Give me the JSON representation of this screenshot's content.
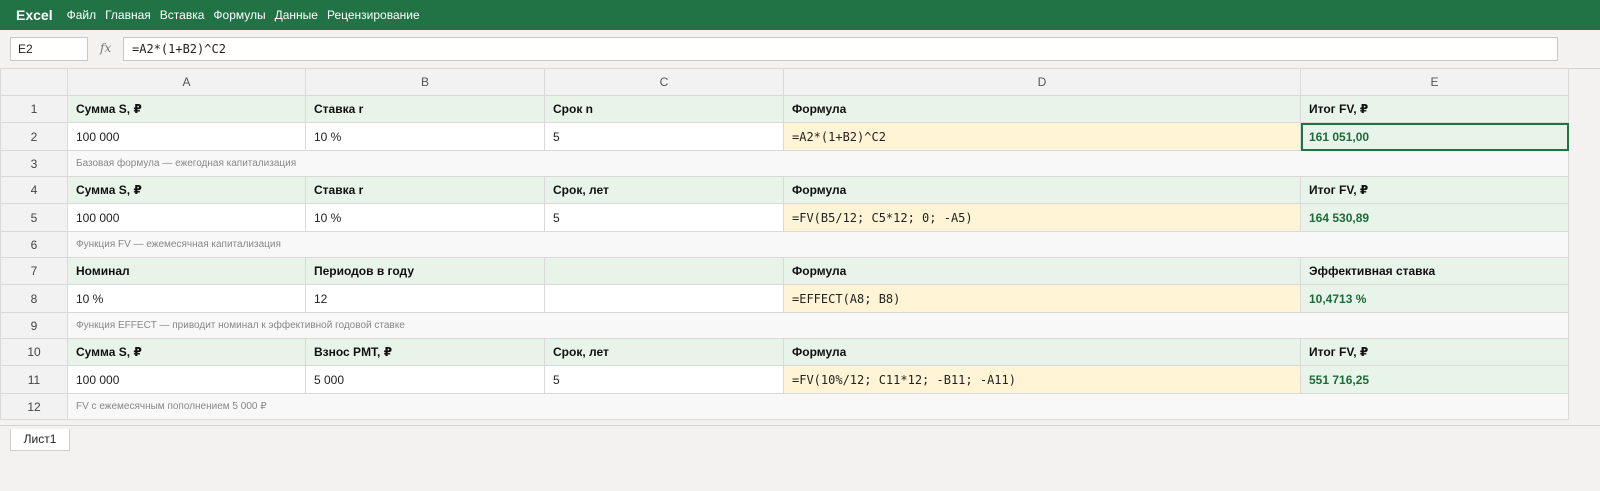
{
  "app": {
    "name": "Excel",
    "menu": [
      "Файл",
      "Главная",
      "Вставка",
      "Формулы",
      "Данные",
      "Рецензирование"
    ]
  },
  "formula_bar": {
    "cell_ref": "E2",
    "fx_label": "fx",
    "formula": "=A2*(1+B2)^C2"
  },
  "grid": {
    "columns": [
      "A",
      "B",
      "C",
      "D",
      "E"
    ],
    "rows": [
      {
        "num": "1",
        "type": "hdr",
        "cells": [
          "Сумма S, ₽",
          "Ставка r",
          "Срок n",
          "Формула",
          "Итог FV, ₽"
        ]
      },
      {
        "num": "2",
        "type": "val",
        "cells": [
          "100 000",
          "10 %",
          "5",
          "=A2*(1+B2)^C2",
          "161 051,00"
        ]
      },
      {
        "num": "3",
        "type": "note",
        "note": "Базовая формула — ежегодная капитализация"
      },
      {
        "num": "4",
        "type": "hdr",
        "cells": [
          "Сумма S, ₽",
          "Ставка r",
          "Срок, лет",
          "Формула",
          "Итог FV, ₽"
        ]
      },
      {
        "num": "5",
        "type": "val",
        "cells": [
          "100 000",
          "10 %",
          "5",
          "=FV(B5/12; C5*12; 0; -A5)",
          "164 530,89"
        ]
      },
      {
        "num": "6",
        "type": "note",
        "note": "Функция FV — ежемесячная капитализация"
      },
      {
        "num": "7",
        "type": "hdr",
        "cells": [
          "Номинал",
          "Периодов в году",
          "",
          "Формула",
          "Эффективная ставка"
        ]
      },
      {
        "num": "8",
        "type": "val",
        "cells": [
          "10 %",
          "12",
          "",
          "=EFFECT(A8; B8)",
          "10,4713 %"
        ]
      },
      {
        "num": "9",
        "type": "note",
        "note": "Функция EFFECT — приводит номинал к эффективной годовой ставке"
      },
      {
        "num": "10",
        "type": "hdr",
        "cells": [
          "Сумма S, ₽",
          "Взнос PMT, ₽",
          "Срок, лет",
          "Формула",
          "Итог FV, ₽"
        ]
      },
      {
        "num": "11",
        "type": "val",
        "cells": [
          "100 000",
          "5 000",
          "5",
          "=FV(10%/12; C11*12; -B11; -A11)",
          "551 716,25"
        ]
      },
      {
        "num": "12",
        "type": "note",
        "note": "FV с ежемесячным пополнением 5 000 ₽"
      }
    ]
  },
  "sheets": [
    "Лист1"
  ],
  "colors": {
    "ribbon": "#217346",
    "header_fill": "#e8f3ea",
    "formula_fill": "#fff5d6",
    "result_text": "#1e6b3a"
  }
}
